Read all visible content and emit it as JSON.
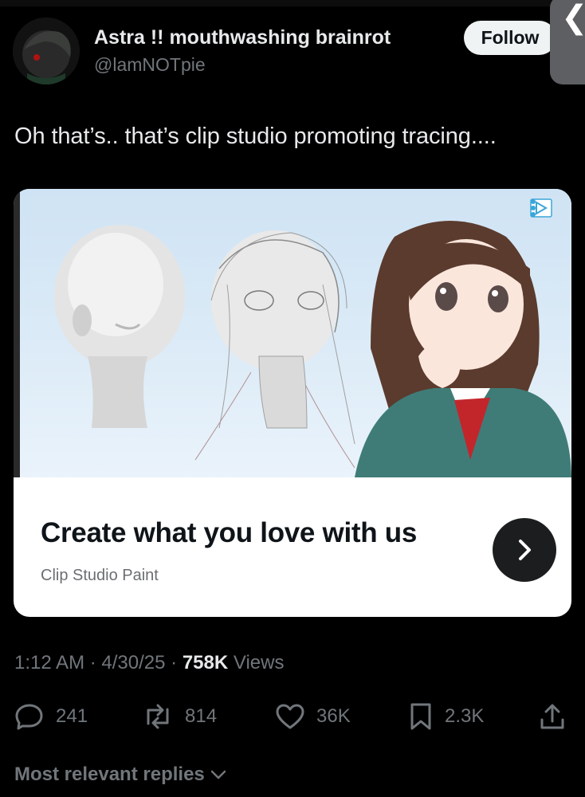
{
  "author": {
    "display_name": "Astra !! mouthwashing brainrot",
    "handle": "@lamNOTpie",
    "follow_label": "Follow"
  },
  "side_tab": {
    "glyph": "❮"
  },
  "tweet": {
    "text": "Oh that’s.. that’s clip studio promoting tracing...."
  },
  "ad": {
    "headline": "Create what you love with us",
    "brand": "Clip Studio Paint",
    "adchoices_icon": "adchoices-triangle-icon",
    "cta_icon": "chevron-right-icon"
  },
  "meta": {
    "time": "1:12 AM",
    "separator": "·",
    "date": "4/30/25",
    "views_count": "758K",
    "views_label": "Views"
  },
  "actions": {
    "replies": "241",
    "reposts": "814",
    "likes": "36K",
    "bookmarks": "2.3K"
  },
  "replies_sort": {
    "label": "Most relevant replies"
  },
  "colors": {
    "background": "#000000",
    "text_primary": "#e7e9ea",
    "text_secondary": "#71767b",
    "follow_bg": "#eff3f4",
    "card_bg": "#ffffff"
  }
}
